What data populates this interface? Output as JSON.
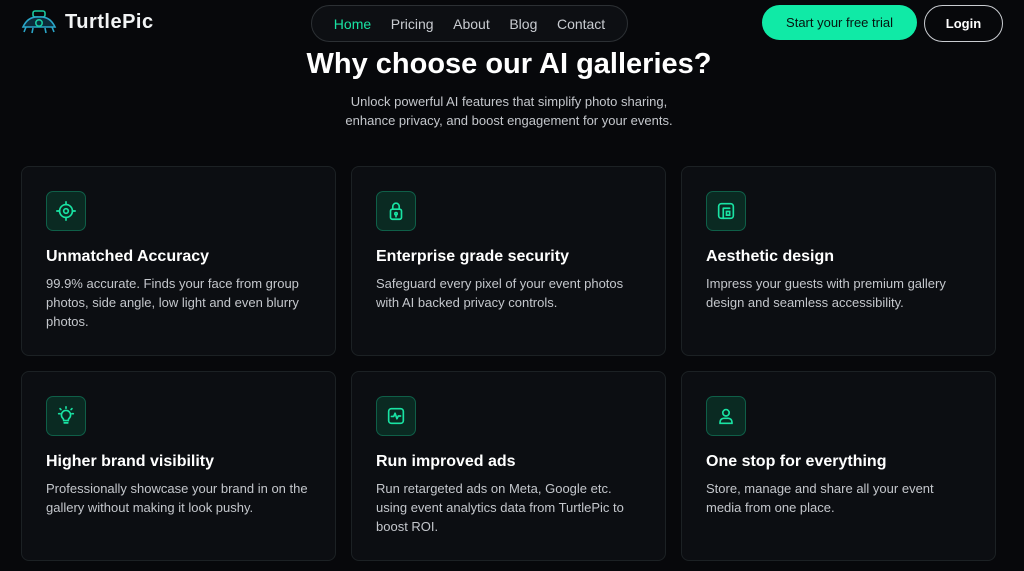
{
  "header": {
    "logo_text": "TurtlePic",
    "nav": [
      "Home",
      "Pricing",
      "About",
      "Blog",
      "Contact"
    ],
    "cta_label": "Start your free trial",
    "login_label": "Login"
  },
  "hero": {
    "title": "Why choose our AI galleries?",
    "subtitle_line1": "Unlock powerful AI features that simplify photo sharing,",
    "subtitle_line2": "enhance privacy, and boost engagement for your events."
  },
  "features": [
    {
      "icon": "target-icon",
      "title": "Unmatched Accuracy",
      "description": "99.9% accurate. Finds your face from group photos, side angle, low light and even blurry photos."
    },
    {
      "icon": "lock-icon",
      "title": "Enterprise grade security",
      "description": "Safeguard every pixel of your event photos with AI backed privacy controls."
    },
    {
      "icon": "layout-icon",
      "title": "Aesthetic design",
      "description": "Impress your guests with premium gallery design and seamless accessibility."
    },
    {
      "icon": "lightbulb-icon",
      "title": "Higher brand visibility",
      "description": "Professionally showcase your brand in on the gallery without making it look pushy."
    },
    {
      "icon": "activity-icon",
      "title": "Run improved ads",
      "description": "Run retargeted ads on Meta, Google etc. using event analytics data from TurtlePic to boost ROI."
    },
    {
      "icon": "user-icon",
      "title": "One stop for everything",
      "description": "Store, manage and share all your event media from one place."
    }
  ],
  "colors": {
    "accent": "#10eaa6",
    "background": "#07080b",
    "card_bg": "#0c0e12"
  }
}
